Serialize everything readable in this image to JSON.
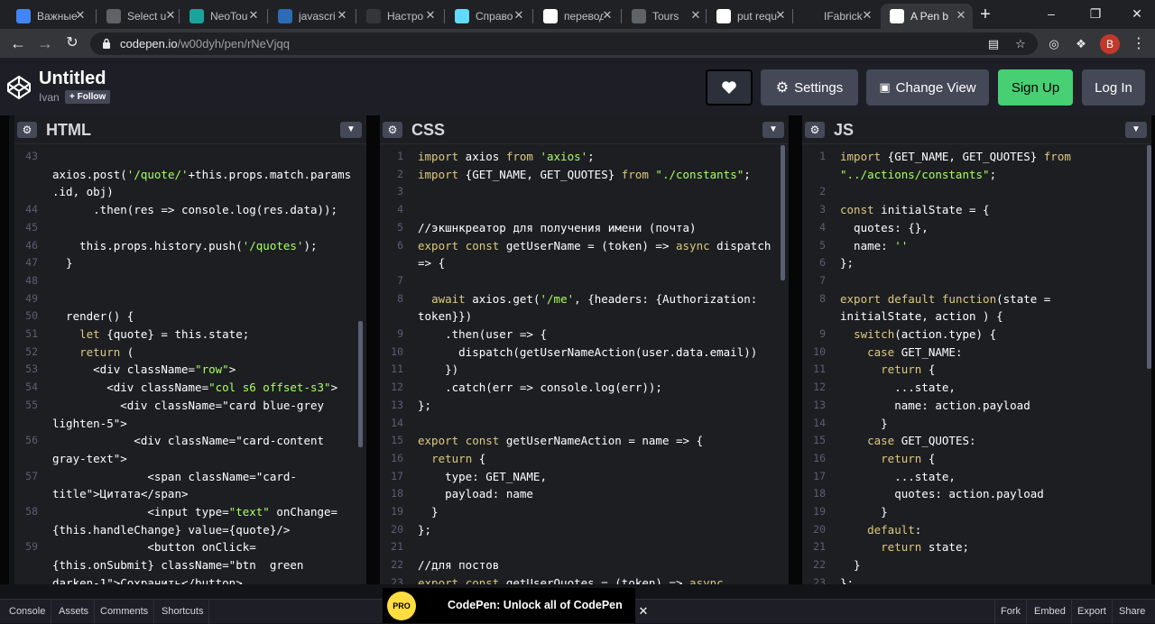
{
  "browser": {
    "tabs": [
      {
        "label": "Важные",
        "icon": "docs-icon",
        "color": "#4285f4"
      },
      {
        "label": "Select u",
        "icon": "globe-icon",
        "color": "#5f6368"
      },
      {
        "label": "NeoTou",
        "icon": "gem-icon",
        "color": "#1aa39b"
      },
      {
        "label": "javascri",
        "icon": "stack-icon",
        "color": "#2d6bb5"
      },
      {
        "label": "Настро",
        "icon": "gear-icon",
        "color": "#35363a"
      },
      {
        "label": "Справо",
        "icon": "react-icon",
        "color": "#61dafb"
      },
      {
        "label": "перевод",
        "icon": "google-icon",
        "color": "#ffffff"
      },
      {
        "label": "Tours",
        "icon": "globe-icon",
        "color": "#5f6368"
      },
      {
        "label": "put requ",
        "icon": "google-icon",
        "color": "#ffffff"
      },
      {
        "label": "IFabrick",
        "icon": "github-icon",
        "color": "#202124"
      },
      {
        "label": "A Pen b",
        "icon": "codepen-icon",
        "color": "#ffffff"
      }
    ],
    "url_host": "codepen.io",
    "url_path": "/w00dyh/pen/rNeVjqq",
    "profile_letter": "B"
  },
  "header": {
    "title": "Untitled",
    "author": "Ivan",
    "follow_label": "+ Follow",
    "settings_label": "Settings",
    "change_view_label": "Change View",
    "signup_label": "Sign Up",
    "login_label": "Log In"
  },
  "panels": {
    "html": {
      "name": "HTML"
    },
    "css": {
      "name": "CSS"
    },
    "js": {
      "name": "JS"
    }
  },
  "html_lines": [
    {
      "n": "43",
      "t": ""
    },
    {
      "n": "",
      "t": "axios.post('/quote/'+this.props.match.params"
    },
    {
      "n": "",
      "t": ".id, obj)"
    },
    {
      "n": "44",
      "t": "      .then(res => console.log(res.data));"
    },
    {
      "n": "45",
      "t": ""
    },
    {
      "n": "46",
      "t": "    this.props.history.push('/quotes');"
    },
    {
      "n": "47",
      "t": "  }"
    },
    {
      "n": "48",
      "t": ""
    },
    {
      "n": "49",
      "t": ""
    },
    {
      "n": "50",
      "t": "  render() {"
    },
    {
      "n": "51",
      "t": "    let {quote} = this.state;"
    },
    {
      "n": "52",
      "t": "    return ("
    },
    {
      "n": "53",
      "t": "      <div className=\"row\">"
    },
    {
      "n": "54",
      "t": "        <div className=\"col s6 offset-s3\">"
    },
    {
      "n": "55",
      "t": "          <div className=\"card blue-grey"
    },
    {
      "n": "",
      "t": "lighten-5\">"
    },
    {
      "n": "56",
      "t": "            <div className=\"card-content"
    },
    {
      "n": "",
      "t": "gray-text\">"
    },
    {
      "n": "57",
      "t": "              <span className=\"card-"
    },
    {
      "n": "",
      "t": "title\">Цитата</span>"
    },
    {
      "n": "58",
      "t": "              <input type=\"text\" onChange="
    },
    {
      "n": "",
      "t": "{this.handleChange} value={quote}/>"
    },
    {
      "n": "59",
      "t": "              <button onClick="
    },
    {
      "n": "",
      "t": "{this.onSubmit} className=\"btn  green"
    },
    {
      "n": "",
      "t": "darken-1\">Сохранить</button>"
    }
  ],
  "css_lines": [
    {
      "n": "1",
      "t": "import axios from 'axios';"
    },
    {
      "n": "2",
      "t": "import {GET_NAME, GET_QUOTES} from \"./constants\";"
    },
    {
      "n": "3",
      "t": ""
    },
    {
      "n": "4",
      "t": ""
    },
    {
      "n": "5",
      "t": "//экшнкреатор для получения имени (почта)"
    },
    {
      "n": "6",
      "t": "export const getUserName = (token) => async dispatch"
    },
    {
      "n": "",
      "t": "=> {"
    },
    {
      "n": "7",
      "t": ""
    },
    {
      "n": "8",
      "t": "  await axios.get('/me', {headers: {Authorization:"
    },
    {
      "n": "",
      "t": "token}})"
    },
    {
      "n": "9",
      "t": "    .then(user => {"
    },
    {
      "n": "10",
      "t": "      dispatch(getUserNameAction(user.data.email))"
    },
    {
      "n": "11",
      "t": "    })"
    },
    {
      "n": "12",
      "t": "    .catch(err => console.log(err));"
    },
    {
      "n": "13",
      "t": "};"
    },
    {
      "n": "14",
      "t": ""
    },
    {
      "n": "15",
      "t": "export const getUserNameAction = name => {"
    },
    {
      "n": "16",
      "t": "  return {"
    },
    {
      "n": "17",
      "t": "    type: GET_NAME,"
    },
    {
      "n": "18",
      "t": "    payload: name"
    },
    {
      "n": "19",
      "t": "  }"
    },
    {
      "n": "20",
      "t": "};"
    },
    {
      "n": "21",
      "t": ""
    },
    {
      "n": "22",
      "t": "//для постов"
    },
    {
      "n": "23",
      "t": "export const getUserQuotes = (token) => async"
    }
  ],
  "js_lines": [
    {
      "n": "1",
      "t": "import {GET_NAME, GET_QUOTES} from"
    },
    {
      "n": "",
      "t": "\"../actions/constants\";"
    },
    {
      "n": "2",
      "t": ""
    },
    {
      "n": "3",
      "t": "const initialState = {"
    },
    {
      "n": "4",
      "t": "  quotes: {},"
    },
    {
      "n": "5",
      "t": "  name: ''"
    },
    {
      "n": "6",
      "t": "};"
    },
    {
      "n": "7",
      "t": ""
    },
    {
      "n": "8",
      "t": "export default function(state ="
    },
    {
      "n": "",
      "t": "initialState, action ) {"
    },
    {
      "n": "9",
      "t": "  switch(action.type) {"
    },
    {
      "n": "10",
      "t": "    case GET_NAME:"
    },
    {
      "n": "11",
      "t": "      return {"
    },
    {
      "n": "12",
      "t": "        ...state,"
    },
    {
      "n": "13",
      "t": "        name: action.payload"
    },
    {
      "n": "14",
      "t": "      }"
    },
    {
      "n": "15",
      "t": "    case GET_QUOTES:"
    },
    {
      "n": "16",
      "t": "      return {"
    },
    {
      "n": "17",
      "t": "        ...state,"
    },
    {
      "n": "18",
      "t": "        quotes: action.payload"
    },
    {
      "n": "19",
      "t": "      }"
    },
    {
      "n": "20",
      "t": "    default:"
    },
    {
      "n": "21",
      "t": "      return state;"
    },
    {
      "n": "22",
      "t": "  }"
    },
    {
      "n": "23",
      "t": "};"
    }
  ],
  "footer": {
    "console_label": "Console",
    "assets_label": "Assets",
    "comments_label": "Comments",
    "shortcuts_label": "Shortcuts",
    "fork_label": "Fork",
    "embed_label": "Embed",
    "export_label": "Export",
    "share_label": "Share",
    "promo_badge": "PRO",
    "promo_text": "CodePen: Unlock all of CodePen"
  }
}
